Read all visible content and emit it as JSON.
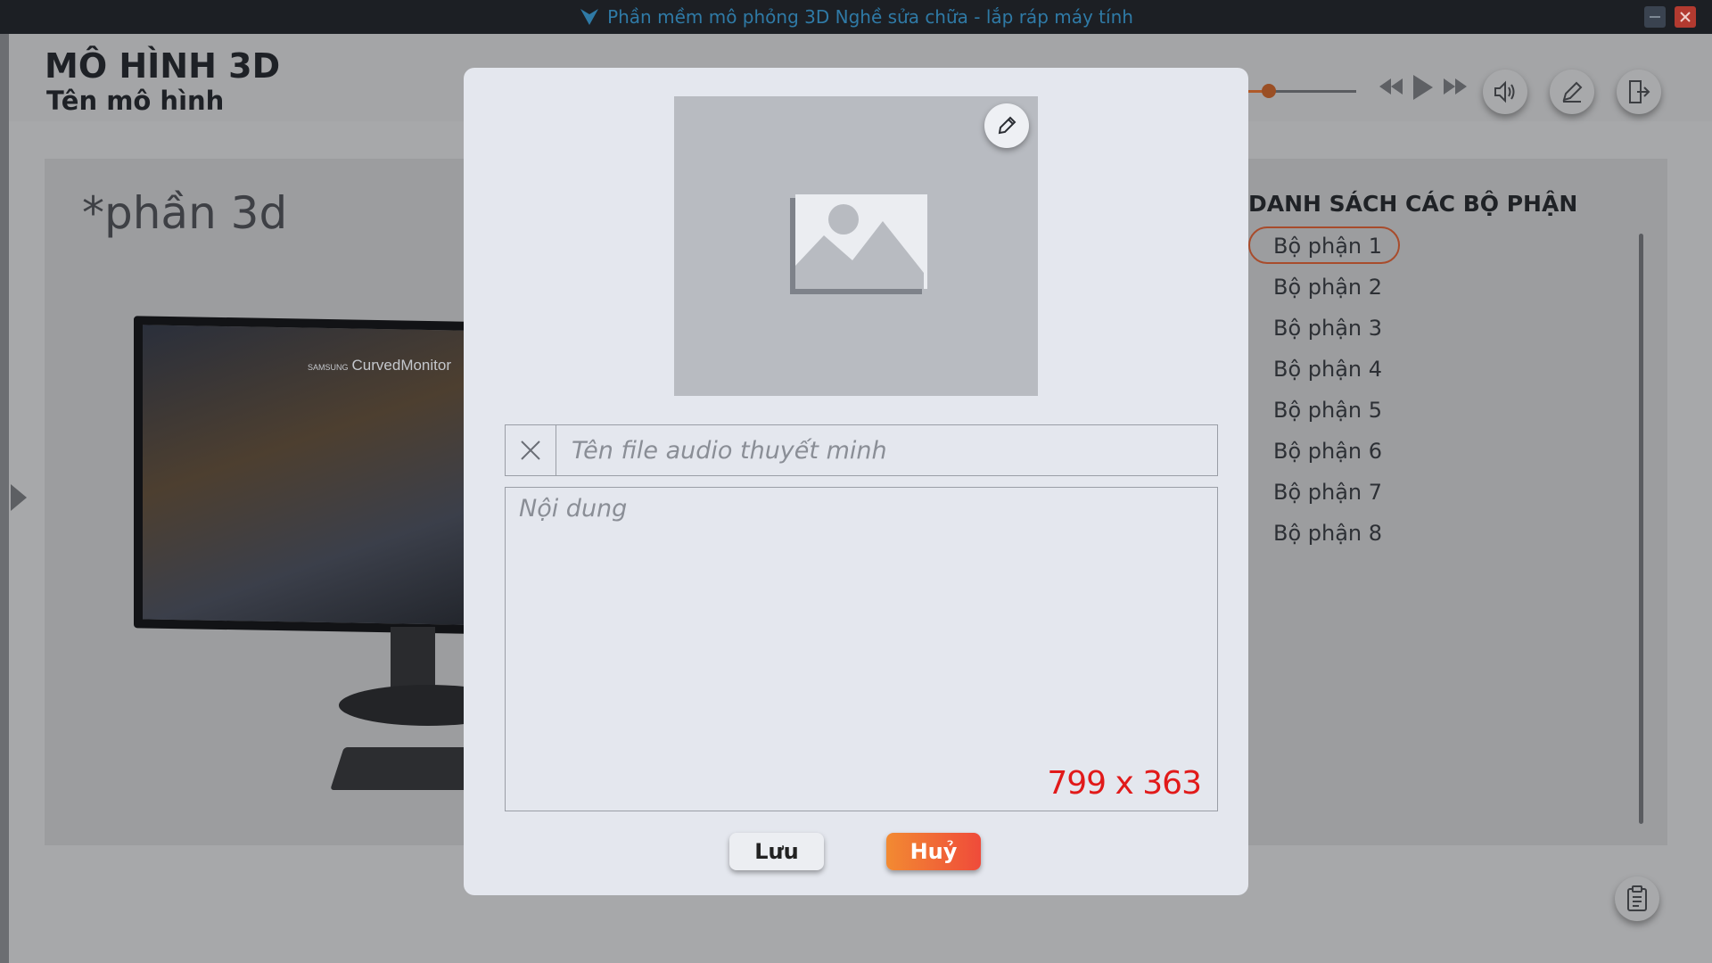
{
  "window": {
    "title": "Phần mềm mô phỏng 3D Nghề sửa chữa - lắp ráp máy tính"
  },
  "header": {
    "title": "MÔ HÌNH 3D",
    "subtitle": "Tên mô hình"
  },
  "toolbar": {
    "volume_level": 0.22,
    "icons": [
      "rewind-icon",
      "play-icon",
      "fast-forward-icon",
      "speaker-icon",
      "pencil-icon",
      "exit-icon"
    ]
  },
  "viewport": {
    "label": "*phần 3d",
    "monitor_brand_small": "SAMSUNG",
    "monitor_brand": "CurvedMonitor"
  },
  "parts": {
    "title": "DANH SÁCH CÁC BỘ PHẬN",
    "items": [
      "Bộ phận 1",
      "Bộ phận 2",
      "Bộ phận 3",
      "Bộ phận 4",
      "Bộ phận 5",
      "Bộ phận 6",
      "Bộ phận 7",
      "Bộ phận 8"
    ],
    "selected_index": 0
  },
  "modal": {
    "audio_placeholder": "Tên file audio thuyết minh",
    "audio_value": "",
    "content_placeholder": "Nội dung",
    "content_value": "",
    "size_label": "799 x 363",
    "save_label": "Lưu",
    "cancel_label": "Huỷ"
  },
  "colors": {
    "accent_orange": "#f28a32",
    "accent_red": "#ef4b3a",
    "size_label_red": "#e11a1a",
    "title_blue": "#2f7aa6"
  }
}
